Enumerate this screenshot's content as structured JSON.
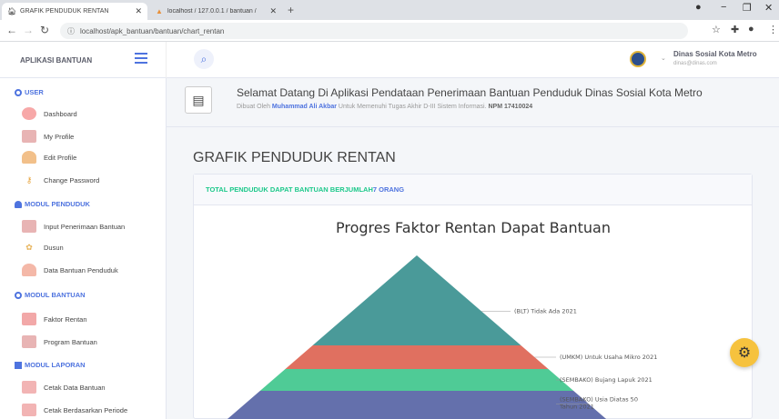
{
  "browser": {
    "active_tab": {
      "icon": "home-icon",
      "title": "GRAFIK PENDUDUK RENTAN"
    },
    "inactive_tab": {
      "icon": "xampp-icon",
      "title": "localhost / 127.0.0.1 / bantuan / "
    },
    "url": "localhost/apk_bantuan/bantuan/chart_rentan"
  },
  "app": {
    "brand": "APLIKASI BANTUAN",
    "user": {
      "name": "Dinas Sosial Kota Metro",
      "email": "dinas@dinas.com"
    }
  },
  "sidebar": {
    "sections": [
      {
        "title": "USER",
        "icon": "circle-icon",
        "items": [
          {
            "label": "Dashboard",
            "icon": "dashboard-icon"
          },
          {
            "label": "My Profile",
            "icon": "id-card-icon"
          },
          {
            "label": "Edit Profile",
            "icon": "user-edit-icon"
          },
          {
            "label": "Change Password",
            "icon": "key-icon"
          }
        ]
      },
      {
        "title": "MODUL PENDUDUK",
        "icon": "users-icon",
        "items": [
          {
            "label": "Input Penerimaan Bantuan",
            "icon": "id-card-icon"
          },
          {
            "label": "Dusun",
            "icon": "gear-icon"
          },
          {
            "label": "Data Bantuan Penduduk",
            "icon": "users-icon"
          }
        ]
      },
      {
        "title": "MODUL BANTUAN",
        "icon": "circle-icon",
        "items": [
          {
            "label": "Faktor Rentan",
            "icon": "medkit-icon"
          },
          {
            "label": "Program Bantuan",
            "icon": "id-card-icon"
          }
        ]
      },
      {
        "title": "MODUL LAPORAN",
        "icon": "book-icon",
        "items": [
          {
            "label": "Cetak Data Bantuan",
            "icon": "printer-icon"
          },
          {
            "label": "Cetak Berdasarkan Periode",
            "icon": "printer-icon"
          }
        ]
      }
    ]
  },
  "welcome": {
    "title": "Selamat Datang Di Aplikasi Pendataan Penerimaan Bantuan Penduduk Dinas Sosial Kota Metro",
    "sub_prefix": "Dibuat Oleh ",
    "sub_name": "Muhammad Ali Akbar",
    "sub_middle": " Untuk Memenuhi Tugas Akhir D-III Sistem Informasi. ",
    "sub_npm": "NPM 17410024"
  },
  "page": {
    "title": "GRAFIK PENDUDUK RENTAN",
    "card_header_prefix": "TOTAL PENDUDUK DAPAT BANTUAN BERJUMLAH ",
    "card_header_count": "7 ORANG"
  },
  "chart_data": {
    "type": "pyramid",
    "title": "Progres Faktor Rentan Dapat Bantuan",
    "segments": [
      {
        "label": "(BLT) Tidak Ada 2021",
        "color": "#4a9a99"
      },
      {
        "label": "(UMKM) Untuk Usaha Mikro 2021",
        "color": "#e07060"
      },
      {
        "label": "(SEMBAKO) Bujang Lapuk 2021",
        "color": "#4fcb96"
      },
      {
        "label": "(SEMBAKO) Usia Diatas 50 Tahun 2021",
        "color": "#6470ac"
      }
    ]
  }
}
